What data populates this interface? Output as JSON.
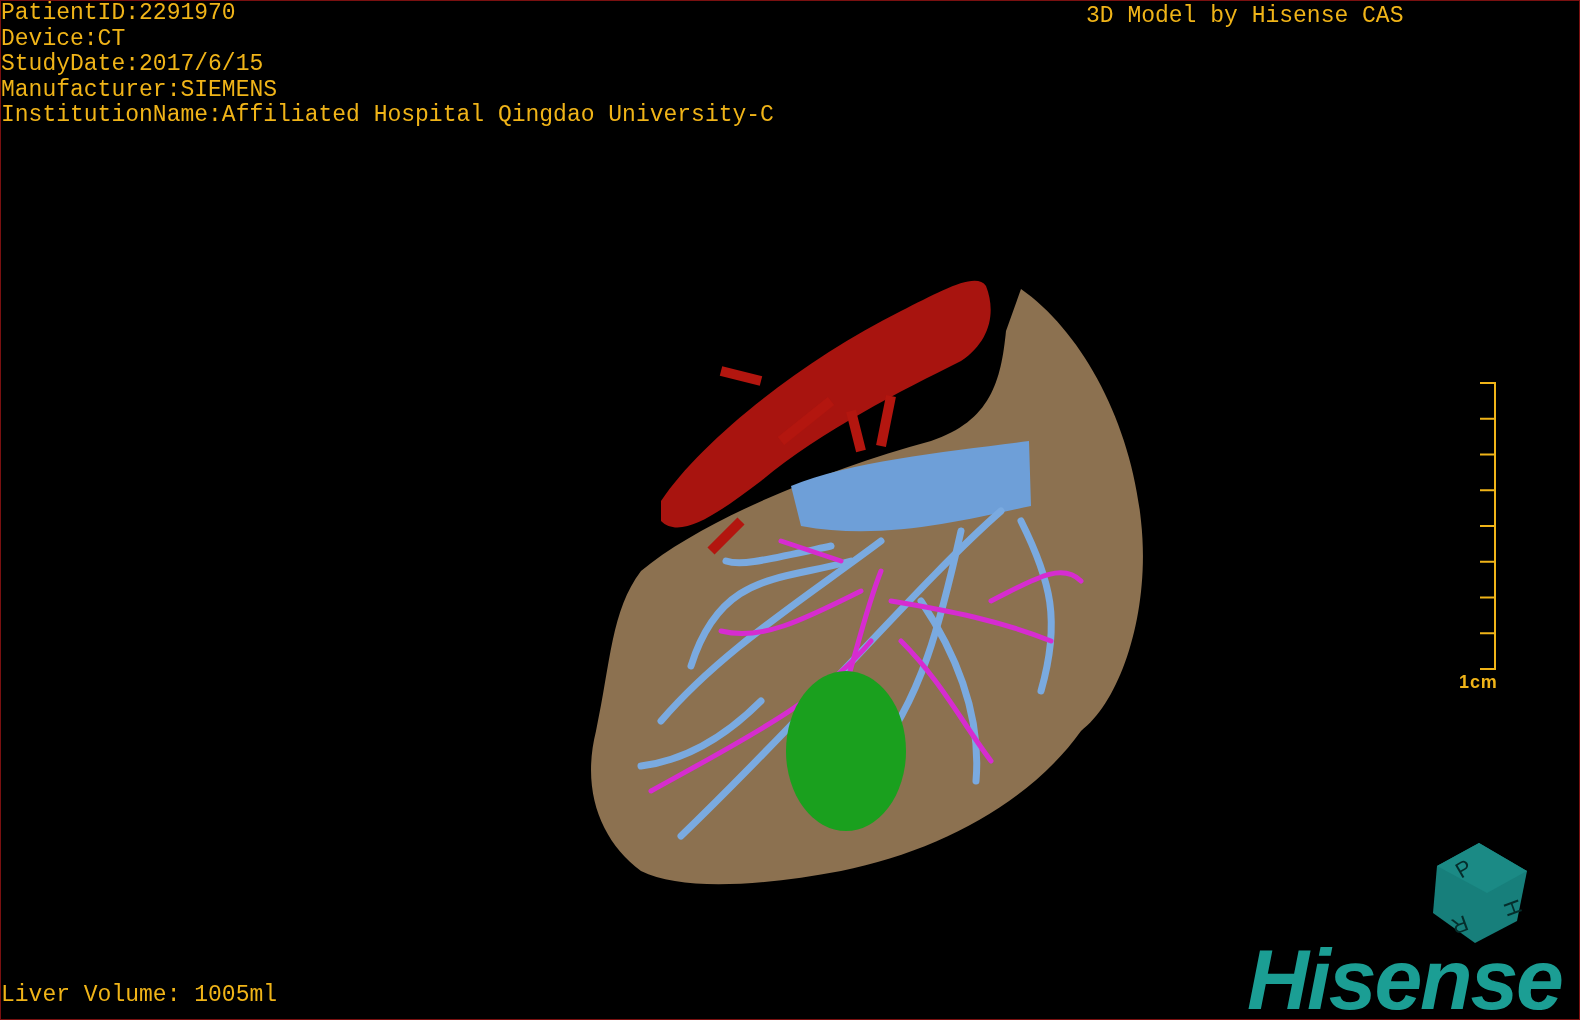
{
  "patient_info": [
    "PatientID:2291970",
    "Device:CT",
    "StudyDate:2017/6/15",
    "Manufacturer:SIEMENS",
    "InstitutionName:Affiliated Hospital Qingdao University-C"
  ],
  "model_credit": "3D Model by Hisense CAS",
  "scale_bar": {
    "label": "1cm"
  },
  "orientation_cube": {
    "faces": [
      "P",
      "H",
      "R"
    ]
  },
  "logo": "Hisense",
  "liver_volume": "Liver Volume: 1005ml"
}
